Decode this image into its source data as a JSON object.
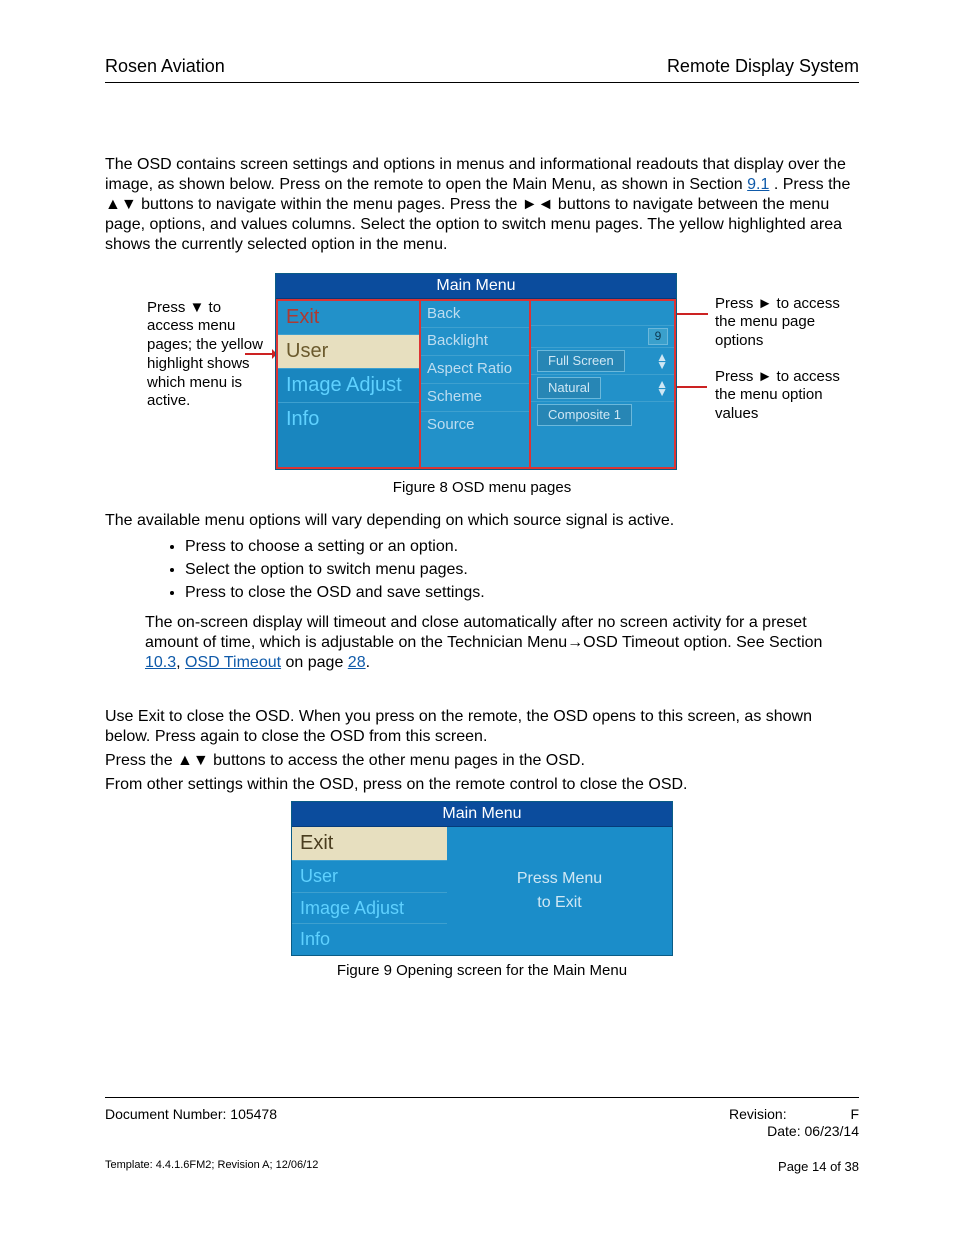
{
  "header": {
    "left": "Rosen Aviation",
    "right": "Remote Display System"
  },
  "intro": {
    "p1a": "The OSD contains screen settings and options in menus and informational readouts that display over the image, as shown below. Press ",
    "p1b": " on the remote to open the Main Menu, as shown in Section ",
    "link91": "9.1",
    "p1c": ". Press the ▲▼ buttons to navigate within the menu pages. Press the ►◄ buttons to navigate between the menu page, options, and values columns. Select the ",
    "p1d": " option to switch menu pages. The yellow highlighted area shows the currently selected option in the menu."
  },
  "callouts": {
    "left": "Press ▼ to access menu pages; the yellow highlight shows which menu is active.",
    "right1": "Press ► to access the menu page options",
    "right2": "Press ► to access the menu option values"
  },
  "osd1": {
    "title": "Main Menu",
    "left": [
      "Exit",
      "User",
      "Image Adjust",
      "Info"
    ],
    "mid": [
      "Back",
      "Backlight",
      "Aspect Ratio",
      "Scheme",
      "Source"
    ],
    "vals": {
      "backlight": "9",
      "aspect": "Full Screen",
      "scheme": "Natural",
      "source": "Composite 1"
    }
  },
  "figcap1": "Figure 8  OSD menu pages",
  "line_avail": "The available menu options will vary depending on which source signal is active.",
  "bullets": {
    "b1a": "Press ",
    "b1b": " to choose a setting or an option.",
    "b2a": "Select the ",
    "b2b": " option to switch menu pages.",
    "b3a": "Press ",
    "b3b": " to close the OSD and save settings."
  },
  "timeout": {
    "a": "The on-screen display will timeout and close automatically after no screen activity for a preset amount of time, which is adjustable on the Technician Menu→OSD Timeout option. See Section",
    "l103": " 10.3",
    "comma": ", ",
    "ltxt": "OSD Timeout",
    "mid": " on page ",
    "lpage": "28",
    "end": "."
  },
  "exit": {
    "p1a": "Use Exit to close the OSD. When you press ",
    "p1b": " on the remote, the OSD opens to this screen, as shown below. Press ",
    "p1c": " again to close the OSD from this screen.",
    "p2": "Press the ▲▼ buttons to access the other menu pages in the OSD.",
    "p3a": "From other settings within the OSD, press ",
    "p3b": " on the remote control to close the OSD."
  },
  "osd2": {
    "title": "Main Menu",
    "left": [
      "Exit",
      "User",
      "Image Adjust",
      "Info"
    ],
    "r1": "Press Menu",
    "r2": "to Exit"
  },
  "figcap2": "Figure 9  Opening screen for the Main Menu",
  "footer": {
    "docnum_l": "Document Number: ",
    "docnum_v": "105478",
    "rev_l": "Revision:",
    "rev_v": "F",
    "date_l": "Date: ",
    "date_v": "06/23/14",
    "tmpl": "Template: 4.4.1.6FM2; Revision A; 12/06/12",
    "page": "Page 14 of 38"
  }
}
